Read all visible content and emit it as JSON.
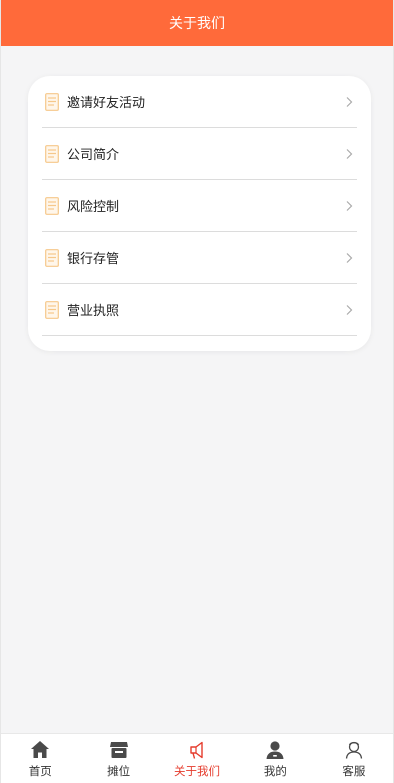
{
  "header": {
    "title": "关于我们"
  },
  "menu": {
    "items": [
      {
        "label": "邀请好友活动",
        "icon": "document-icon"
      },
      {
        "label": "公司简介",
        "icon": "document-icon"
      },
      {
        "label": "风险控制",
        "icon": "document-icon"
      },
      {
        "label": "银行存管",
        "icon": "document-icon"
      },
      {
        "label": "营业执照",
        "icon": "document-icon"
      }
    ]
  },
  "tabbar": {
    "tabs": [
      {
        "label": "首页",
        "icon": "home-icon"
      },
      {
        "label": "摊位",
        "icon": "store-icon"
      },
      {
        "label": "关于我们",
        "icon": "megaphone-icon",
        "active": true
      },
      {
        "label": "我的",
        "icon": "user-icon"
      },
      {
        "label": "客服",
        "icon": "customer-service-icon"
      }
    ]
  },
  "colors": {
    "header_bg": "#ff6a3a",
    "active_tab": "#e53b2c",
    "doc_icon": "#f6c88a"
  }
}
